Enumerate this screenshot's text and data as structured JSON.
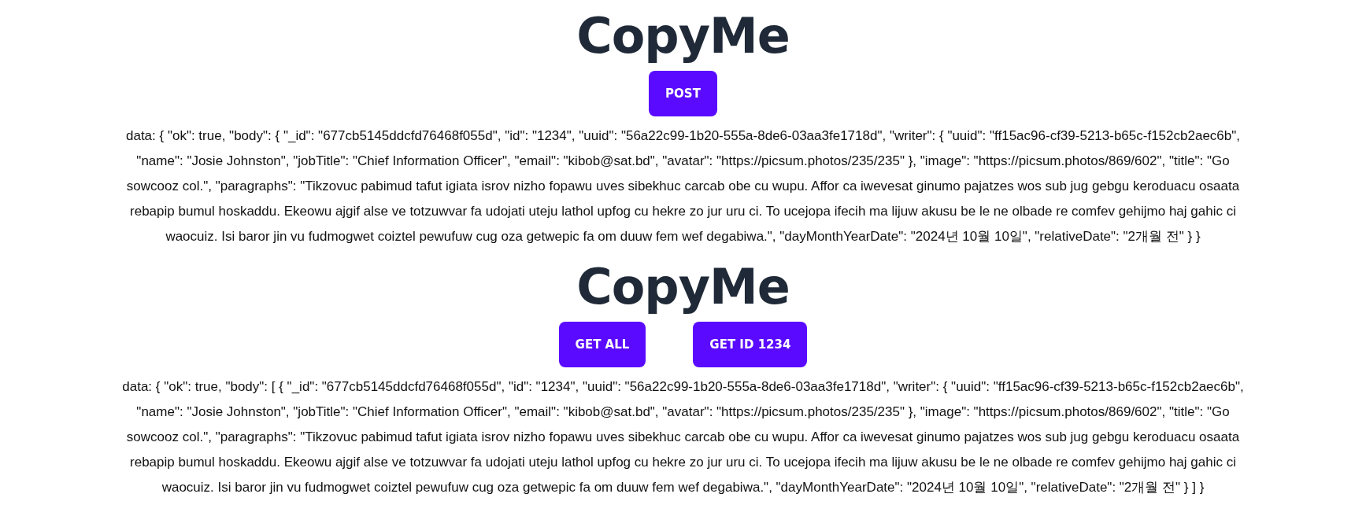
{
  "sections": [
    {
      "title": "CopyMe",
      "buttons": [
        {
          "label": "POST"
        }
      ],
      "output_lines": [
        "data: { \"ok\": true, \"body\": { \"_id\": \"677cb5145ddcfd76468f055d\", \"id\": \"1234\", \"uuid\": \"56a22c99-1b20-555a-8de6-03aa3fe1718d\", \"writer\": { \"uuid\": \"ff15ac96-cf39-5213-b65c-f152cb2aec6b\",",
        "\"name\": \"Josie Johnston\", \"jobTitle\": \"Chief Information Officer\", \"email\": \"kibob@sat.bd\", \"avatar\": \"https://picsum.photos/235/235\" }, \"image\": \"https://picsum.photos/869/602\", \"title\": \"Go",
        "sowcooz col.\", \"paragraphs\": \"Tikzovuc pabimud tafut igiata isrov nizho fopawu uves sibekhuc carcab obe cu wupu. Affor ca iwevesat ginumo pajatzes wos sub jug gebgu keroduacu osaata",
        "rebapip bumul hoskaddu. Ekeowu ajgif alse ve totzuwvar fa udojati uteju lathol upfog cu hekre zo jur uru ci. To ucejopa ifecih ma lijuw akusu be le ne olbade re comfev gehijmo haj gahic ci",
        "waocuiz. Isi baror jin vu fudmogwet coiztel pewufuw cug oza getwepic fa om duuw fem wef degabiwa.\", \"dayMonthYearDate\": \"2024년 10월 10일\", \"relativeDate\": \"2개월 전\" } }"
      ]
    },
    {
      "title": "CopyMe",
      "buttons": [
        {
          "label": "GET ALL"
        },
        {
          "label": "GET ID 1234"
        }
      ],
      "output_lines": [
        "data: { \"ok\": true, \"body\": [ { \"_id\": \"677cb5145ddcfd76468f055d\", \"id\": \"1234\", \"uuid\": \"56a22c99-1b20-555a-8de6-03aa3fe1718d\", \"writer\": { \"uuid\": \"ff15ac96-cf39-5213-b65c-f152cb2aec6b\",",
        "\"name\": \"Josie Johnston\", \"jobTitle\": \"Chief Information Officer\", \"email\": \"kibob@sat.bd\", \"avatar\": \"https://picsum.photos/235/235\" }, \"image\": \"https://picsum.photos/869/602\", \"title\": \"Go",
        "sowcooz col.\", \"paragraphs\": \"Tikzovuc pabimud tafut igiata isrov nizho fopawu uves sibekhuc carcab obe cu wupu. Affor ca iwevesat ginumo pajatzes wos sub jug gebgu keroduacu osaata",
        "rebapip bumul hoskaddu. Ekeowu ajgif alse ve totzuwvar fa udojati uteju lathol upfog cu hekre zo jur uru ci. To ucejopa ifecih ma lijuw akusu be le ne olbade re comfev gehijmo haj gahic ci",
        "waocuiz. Isi baror jin vu fudmogwet coiztel pewufuw cug oza getwepic fa om duuw fem wef degabiwa.\", \"dayMonthYearDate\": \"2024년 10월 10일\", \"relativeDate\": \"2개월 전\" } ] }"
      ]
    }
  ]
}
